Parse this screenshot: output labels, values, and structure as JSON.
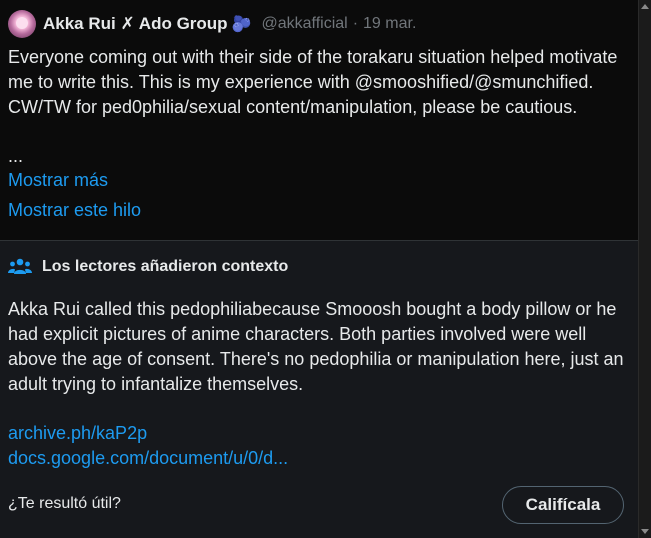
{
  "post": {
    "display_name": "Akka Rui ✗ Ado Group",
    "name_emoji": "🫐",
    "handle": "@akkafficial",
    "separator": "·",
    "time": "19 mar.",
    "text": "Everyone coming out with their side of the torakaru situation helped motivate me to write this. This is my experience with @smooshified/@smunchified. CW/TW for ped0philia/sexual content/manipulation, please be cautious.",
    "ellipsis": "...",
    "show_more": "Mostrar más",
    "show_thread": "Mostrar este hilo"
  },
  "community_note": {
    "title": "Los lectores añadieron contexto",
    "text": "Akka Rui called this pedophiliabecause Smooosh bought a body pillow or he had explicit pictures of anime characters. Both parties involved were well above the age of consent. There's no pedophilia or manipulation here, just an adult trying to infantalize themselves.",
    "links": [
      "archive.ph/kaP2p",
      "docs.google.com/document/u/0/d..."
    ],
    "helpful_question": "¿Te resultó útil?",
    "rate_button": "Califícala"
  },
  "colors": {
    "link": "#1d9bf0",
    "text": "#e7e9ea",
    "muted": "#71767b",
    "note_bg": "#16181c"
  }
}
